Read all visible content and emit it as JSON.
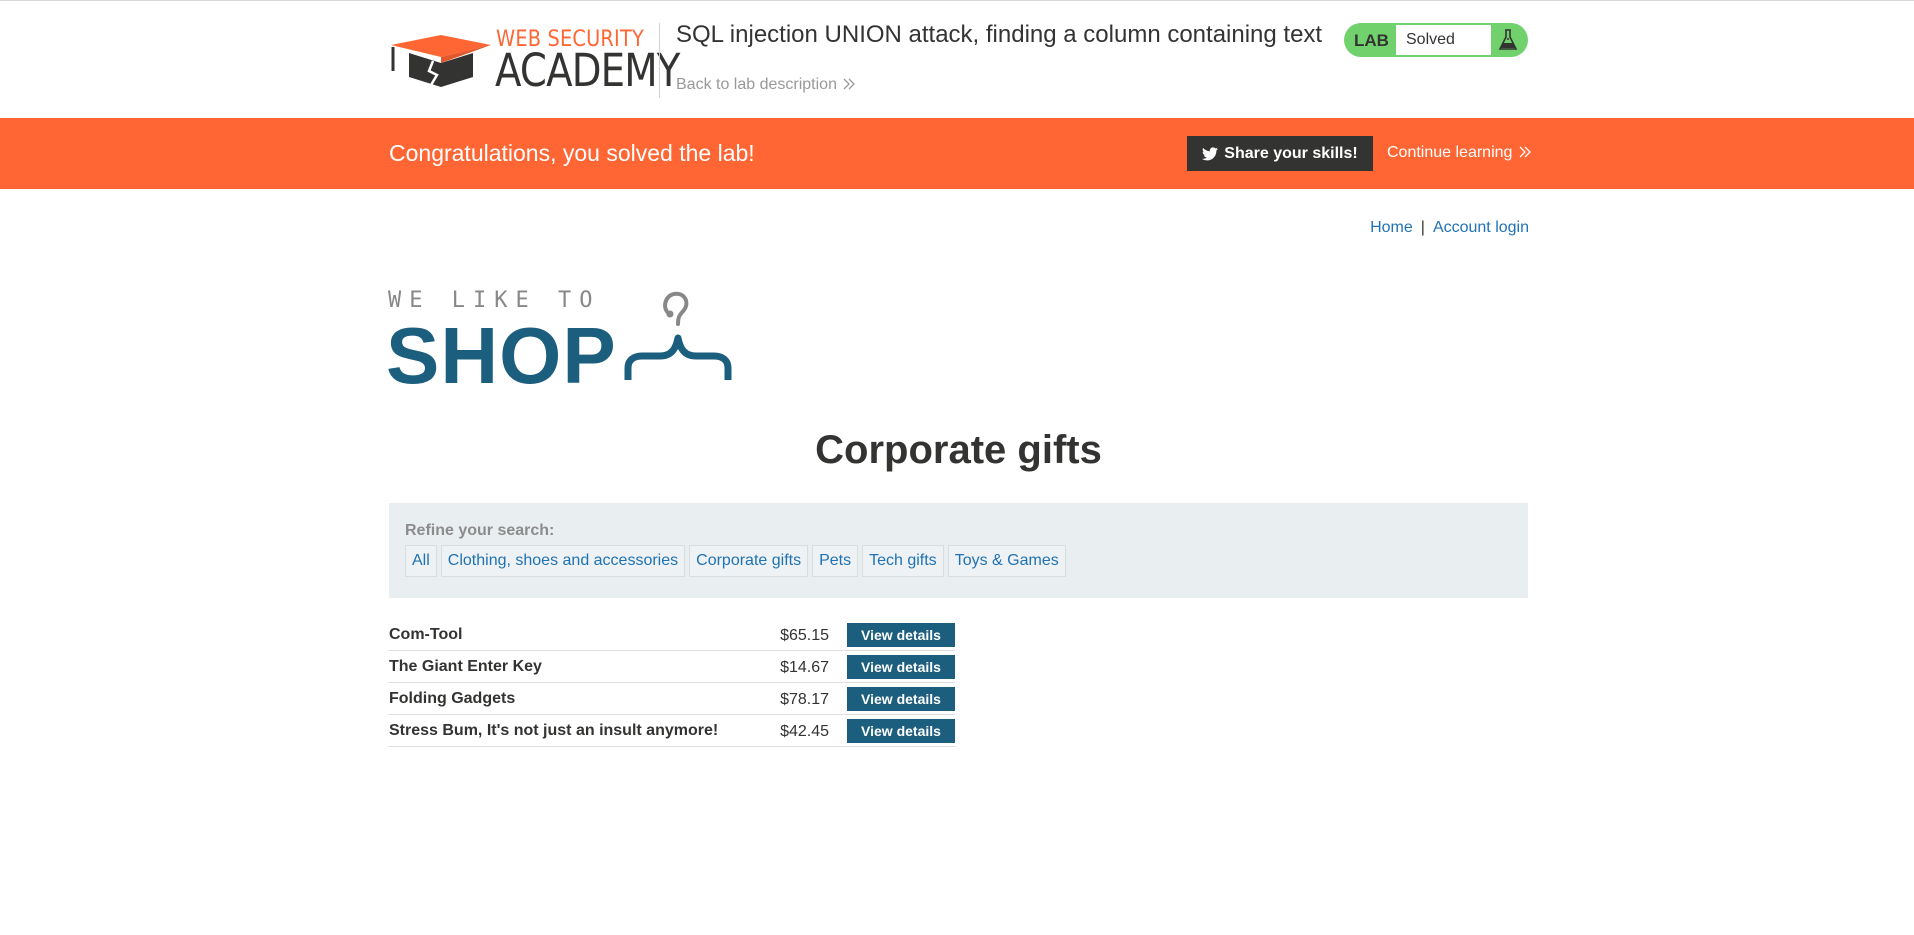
{
  "academy_header": {
    "logo_top": "WEB SECURITY",
    "logo_bottom": "ACADEMY",
    "lab_title": "SQL injection UNION attack, finding a column containing text",
    "back_link": "Back to lab description",
    "lab_badge": "LAB",
    "lab_status": "Solved",
    "logo_icon": "graduation-cap-icon",
    "status_icon": "flask-icon"
  },
  "banner": {
    "message": "Congratulations, you solved the lab!",
    "share_label": "Share your skills!",
    "share_icon": "twitter-icon",
    "continue_label": "Continue learning",
    "background": "#ff6633"
  },
  "nav": {
    "home": "Home",
    "separator": "|",
    "account": "Account login"
  },
  "shop_logo": {
    "small": "WE LIKE TO",
    "big": "SHOP",
    "icon": "hanger-icon",
    "color": "#1b5e7e"
  },
  "page_title": "Corporate gifts",
  "filters": {
    "label": "Refine your search:",
    "items": [
      "All",
      "Clothing, shoes and accessories",
      "Corporate gifts",
      "Pets",
      "Tech gifts",
      "Toys & Games"
    ]
  },
  "products": [
    {
      "name": "Com-Tool",
      "price": "$65.15",
      "button": "View details"
    },
    {
      "name": "The Giant Enter Key",
      "price": "$14.67",
      "button": "View details"
    },
    {
      "name": "Folding Gadgets",
      "price": "$78.17",
      "button": "View details"
    },
    {
      "name": "Stress Bum, It's not just an insult anymore!",
      "price": "$42.45",
      "button": "View details"
    }
  ]
}
